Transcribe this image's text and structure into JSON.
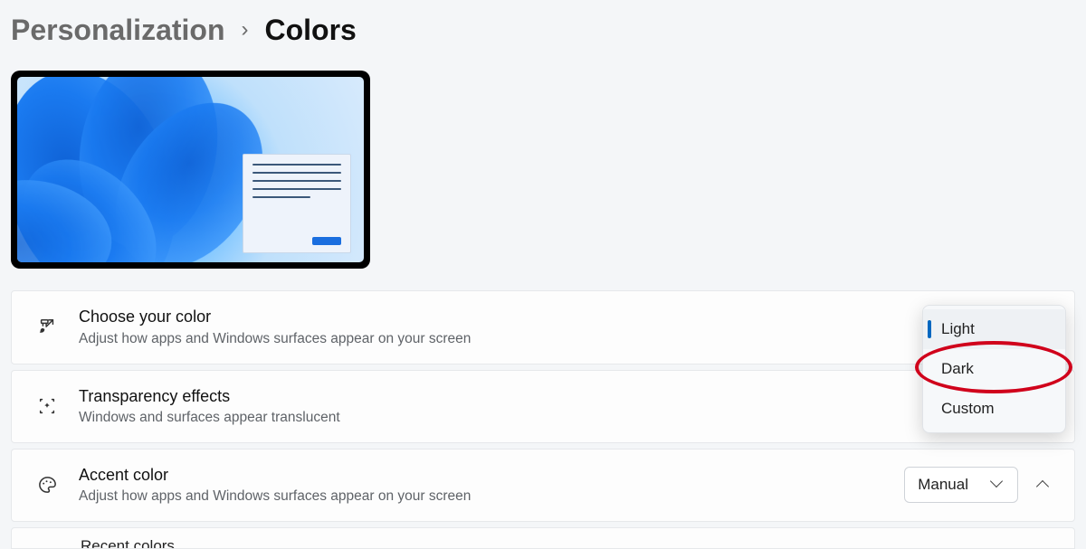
{
  "breadcrumb": {
    "parent": "Personalization",
    "current": "Colors"
  },
  "rows": {
    "choose_color": {
      "title": "Choose your color",
      "sub": "Adjust how apps and Windows surfaces appear on your screen"
    },
    "transparency": {
      "title": "Transparency effects",
      "sub": "Windows and surfaces appear translucent"
    },
    "accent": {
      "title": "Accent color",
      "sub": "Adjust how apps and Windows surfaces appear on your screen",
      "select_value": "Manual"
    },
    "recent_partial": "Recent colors"
  },
  "dropdown": {
    "options": [
      "Light",
      "Dark",
      "Custom"
    ],
    "selected": "Light",
    "highlighted": "Dark"
  }
}
